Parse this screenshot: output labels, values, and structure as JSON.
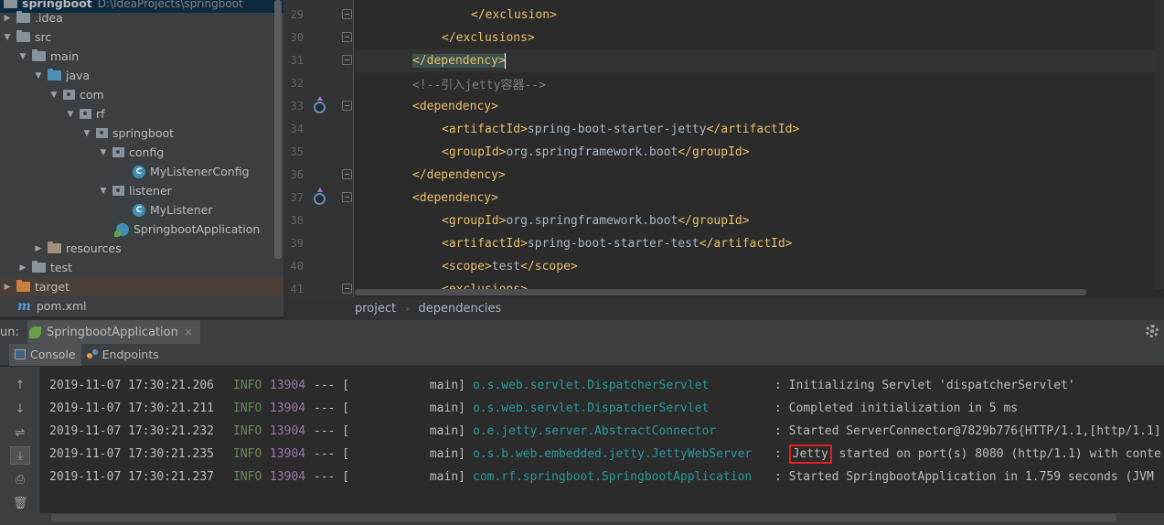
{
  "project_tree": {
    "root_label": "springboot",
    "root_path": "D:\\IdeaProjects\\springboot",
    "items": [
      {
        "label": ".idea"
      },
      {
        "label": "src"
      },
      {
        "label": "main"
      },
      {
        "label": "java"
      },
      {
        "label": "com"
      },
      {
        "label": "rf"
      },
      {
        "label": "springboot"
      },
      {
        "label": "config"
      },
      {
        "label": "MyListenerConfig"
      },
      {
        "label": "listener"
      },
      {
        "label": "MyListener"
      },
      {
        "label": "SpringbootApplication"
      },
      {
        "label": "resources"
      },
      {
        "label": "test"
      },
      {
        "label": "target"
      },
      {
        "label": "pom.xml"
      }
    ]
  },
  "editor": {
    "line_numbers": [
      "29",
      "30",
      "31",
      "32",
      "33",
      "34",
      "35",
      "36",
      "37",
      "38",
      "39",
      "40",
      "41"
    ],
    "lines": [
      {
        "open": "</exclusion>",
        "text": "",
        "close": ""
      },
      {
        "open": "</exclusions>",
        "text": "",
        "close": ""
      },
      {
        "open": "</dependency>",
        "text": "",
        "close": ""
      },
      {
        "comment": "<!--引入jetty容器-->"
      },
      {
        "open": "<dependency>",
        "text": "",
        "close": ""
      },
      {
        "open": "<artifactId>",
        "text": "spring-boot-starter-jetty",
        "close": "</artifactId>"
      },
      {
        "open": "<groupId>",
        "text": "org.springframework.boot",
        "close": "</groupId>"
      },
      {
        "open": "</dependency>",
        "text": "",
        "close": ""
      },
      {
        "open": "<dependency>",
        "text": "",
        "close": ""
      },
      {
        "open": "<groupId>",
        "text": "org.springframework.boot",
        "close": "</groupId>"
      },
      {
        "open": "<artifactId>",
        "text": "spring-boot-starter-test",
        "close": "</artifactId>"
      },
      {
        "open": "<scope>",
        "text": "test",
        "close": "</scope>"
      },
      {
        "open": "<exclusions>",
        "text": "",
        "close": ""
      }
    ],
    "breadcrumb": [
      "project",
      "dependencies"
    ]
  },
  "run_window": {
    "label": "un:",
    "tab_label": "SpringbootApplication",
    "close_glyph": "×",
    "subtabs": [
      "Console",
      "Endpoints"
    ]
  },
  "console": {
    "lines": [
      {
        "time": "2019-11-07 17:30:21.206",
        "level": "INFO",
        "pid": "13904",
        "sep": "--- [",
        "thread": "main]",
        "logger": "o.s.web.servlet.DispatcherServlet",
        "msg": ": Initializing Servlet 'dispatcherServlet'"
      },
      {
        "time": "2019-11-07 17:30:21.211",
        "level": "INFO",
        "pid": "13904",
        "sep": "--- [",
        "thread": "main]",
        "logger": "o.s.web.servlet.DispatcherServlet",
        "msg": ": Completed initialization in 5 ms"
      },
      {
        "time": "2019-11-07 17:30:21.232",
        "level": "INFO",
        "pid": "13904",
        "sep": "--- [",
        "thread": "main]",
        "logger": "o.e.jetty.server.AbstractConnector",
        "msg": ": Started ServerConnector@7829b776{HTTP/1.1,[http/1.1]"
      },
      {
        "time": "2019-11-07 17:30:21.235",
        "level": "INFO",
        "pid": "13904",
        "sep": "--- [",
        "thread": "main]",
        "logger": "o.s.b.web.embedded.jetty.JettyWebServer",
        "msg_prefix": ": ",
        "msg_highlight": "Jetty",
        "msg": " started on port(s) 8080 (http/1.1) with conte"
      },
      {
        "time": "2019-11-07 17:30:21.237",
        "level": "INFO",
        "pid": "13904",
        "sep": "--- [",
        "thread": "main]",
        "logger": "com.rf.springboot.SpringbootApplication",
        "msg": ": Started SpringbootApplication in 1.759 seconds (JVM"
      }
    ]
  },
  "colors": {
    "tag": "#e8bf6a",
    "text": "#a9b7c6",
    "comment": "#808080",
    "info": "#6a8759",
    "pid": "#9876aa",
    "logger": "#299999",
    "highlight_box": "#e02020"
  }
}
